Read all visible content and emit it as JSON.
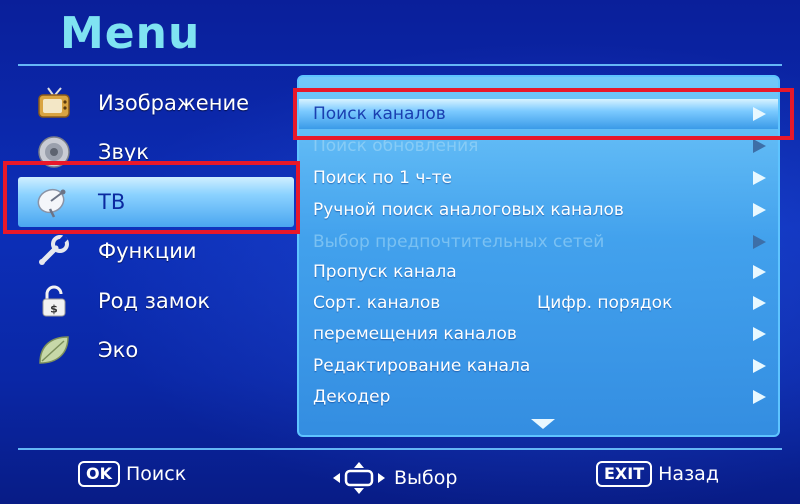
{
  "header": {
    "title": "Menu"
  },
  "sidebar": {
    "items": [
      {
        "label": "Изображение",
        "icon": "tv-icon"
      },
      {
        "label": "Звук",
        "icon": "speaker-icon"
      },
      {
        "label": "ТВ",
        "icon": "satellite-dish-icon",
        "active": true
      },
      {
        "label": "Функции",
        "icon": "wrench-icon"
      },
      {
        "label": "Род замок",
        "icon": "lock-icon"
      },
      {
        "label": "Эко",
        "icon": "leaf-icon"
      }
    ]
  },
  "list": {
    "items": [
      {
        "label": "Поиск каналов",
        "state": "selected"
      },
      {
        "label": "Поиск обновления",
        "state": "disabled"
      },
      {
        "label": "Поиск по 1 ч-те",
        "state": "normal"
      },
      {
        "label": "Ручной поиск аналоговых каналов",
        "state": "normal"
      },
      {
        "label": "Выбор предпочтительных сетей",
        "state": "disabled"
      },
      {
        "label": "Пропуск канала",
        "state": "normal"
      },
      {
        "label": "Сорт. каналов",
        "value": "Цифр. порядок",
        "state": "normal"
      },
      {
        "label": "перемещения каналов",
        "state": "normal"
      },
      {
        "label": "Редактирование канала",
        "state": "normal"
      },
      {
        "label": "Декодер",
        "state": "normal"
      }
    ]
  },
  "footer": {
    "ok_key": "OK",
    "ok_label": "Поиск",
    "nav_label": "Выбор",
    "exit_key": "EXIT",
    "exit_label": "Назад"
  },
  "colors": {
    "background": "#0c2fb8",
    "title": "#7fe3f2",
    "highlight": "#e8182a",
    "panel": "#5ab4f0"
  }
}
